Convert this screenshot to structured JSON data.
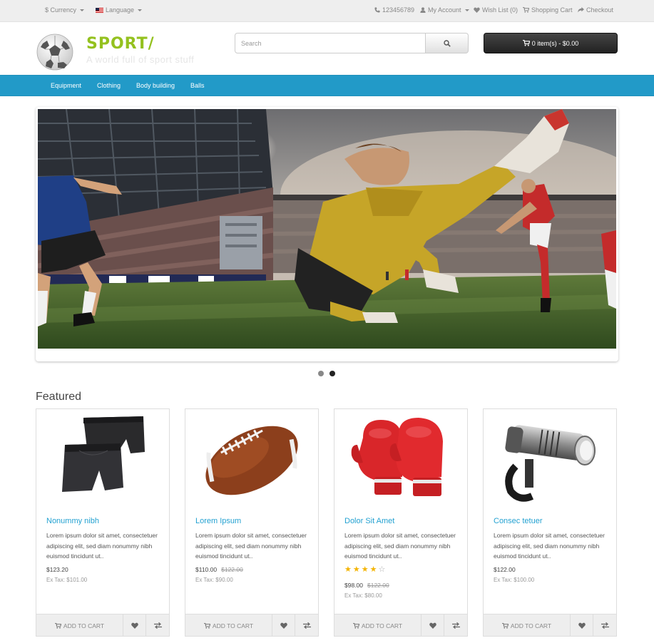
{
  "topbar": {
    "currency": "$ Currency",
    "language": "Language",
    "phone": "123456789",
    "my_account": "My Account",
    "wish_list": "Wish List (0)",
    "shopping_cart": "Shopping Cart",
    "checkout": "Checkout"
  },
  "header": {
    "logo_title": "SPORT/",
    "logo_tagline": "A world full of sport stuff",
    "search_placeholder": "Search",
    "cart_label": "0 item(s) - $0.00"
  },
  "nav": {
    "items": [
      "Equipment",
      "Clothing",
      "Body building",
      "Balls"
    ]
  },
  "slideshow": {
    "dots": 2,
    "active_dot": 1
  },
  "featured": {
    "title": "Featured",
    "products": [
      {
        "name": "Nonummy nibh",
        "description": "Lorem ipsum dolor sit amet, consectetuer adipiscing elit, sed diam nonummy nibh euismod tincidunt ut..",
        "price": "$123.20",
        "price_old": "",
        "ex_tax": "Ex Tax: $101.00",
        "rating": 0,
        "image": "shorts"
      },
      {
        "name": "Lorem Ipsum",
        "description": "Lorem ipsum dolor sit amet, consectetuer adipiscing elit, sed diam nonummy nibh euismod tincidunt ut..",
        "price": "$110.00",
        "price_old": "$122.00",
        "ex_tax": "Ex Tax: $90.00",
        "rating": 0,
        "image": "football"
      },
      {
        "name": "Dolor Sit Amet",
        "description": "Lorem ipsum dolor sit amet, consectetuer adipiscing elit, sed diam nonummy nibh euismod tincidunt ut..",
        "price": "$98.00",
        "price_old": "$122.00",
        "ex_tax": "Ex Tax: $80.00",
        "rating": 4,
        "image": "boxing-gloves"
      },
      {
        "name": "Consec tetuer",
        "description": "Lorem ipsum dolor sit amet, consectetuer adipiscing elit, sed diam nonummy nibh euismod tincidunt ut..",
        "price": "$122.00",
        "price_old": "",
        "ex_tax": "Ex Tax: $100.00",
        "rating": 0,
        "image": "bike-light"
      }
    ],
    "add_to_cart_label": "ADD TO CART"
  },
  "colors": {
    "accent": "#229ac8",
    "logo": "#94c11f",
    "link": "#23a1d1",
    "star": "#f4b400"
  }
}
